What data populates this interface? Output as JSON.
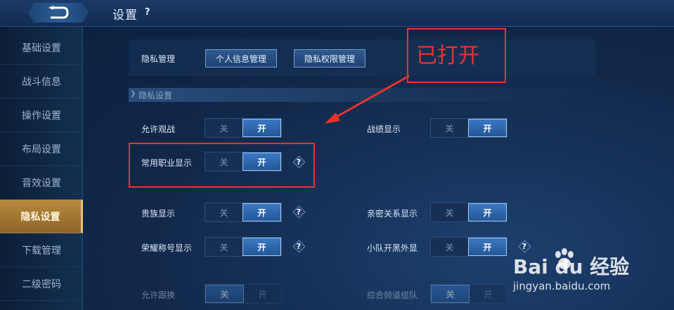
{
  "header": {
    "title": "设置",
    "help": "?"
  },
  "sidebar": {
    "items": [
      {
        "label": "基础设置",
        "active": false
      },
      {
        "label": "战斗信息",
        "active": false
      },
      {
        "label": "操作设置",
        "active": false
      },
      {
        "label": "布局设置",
        "active": false
      },
      {
        "label": "音效设置",
        "active": false
      },
      {
        "label": "隐私设置",
        "active": true
      },
      {
        "label": "下载管理",
        "active": false
      },
      {
        "label": "二级密码",
        "active": false
      }
    ]
  },
  "privacy_mgmt": {
    "label": "隐私管理",
    "personal_btn": "个人信息管理",
    "permission_btn": "隐私权限管理"
  },
  "section": {
    "title": "隐私设置"
  },
  "toggle_text": {
    "off": "关",
    "on": "开"
  },
  "settings": {
    "allow_watch": {
      "label": "允许观战",
      "value": "开"
    },
    "record_display": {
      "label": "战绩显示",
      "value": "开"
    },
    "common_role": {
      "label": "常用职业显示",
      "value": "开"
    },
    "noble_display": {
      "label": "贵族显示",
      "value": "开"
    },
    "intimate_display": {
      "label": "亲密关系显示",
      "value": "开"
    },
    "honor_title": {
      "label": "荣耀称号显示",
      "value": "开"
    },
    "team_black": {
      "label": "小队开黑外显",
      "value": "开"
    },
    "row6_left": {
      "label": "允许跟换",
      "value": "关"
    },
    "row6_right": {
      "label": "综合频道组队",
      "value": "关"
    }
  },
  "annotation": {
    "text": "已打开",
    "color": "#e8332b"
  },
  "watermark": {
    "brand": "Bai du 经验",
    "url": "jingyan.baidu.com"
  }
}
